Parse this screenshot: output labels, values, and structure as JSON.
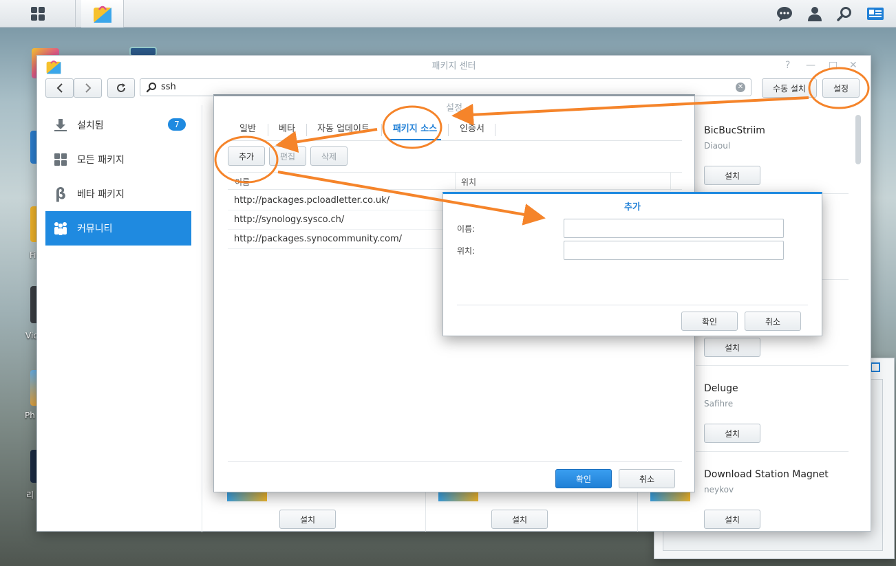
{
  "window": {
    "title": "패키지 센터",
    "search_value": "ssh",
    "manual_install_label": "수동 설치",
    "settings_label": "설정",
    "controls": {
      "help": "?",
      "minimize": "—",
      "maximize": "□",
      "close": "✕"
    }
  },
  "desktop": {
    "labels": [
      "Fi",
      "Vic",
      "Ph",
      "리"
    ]
  },
  "sidebar": {
    "items": [
      {
        "label": "설치됨",
        "icon": "download-icon",
        "badge": "7"
      },
      {
        "label": "모든 패키지",
        "icon": "grid-icon"
      },
      {
        "label": "베타 패키지",
        "icon": "beta-icon"
      },
      {
        "label": "커뮤니티",
        "icon": "community-icon"
      }
    ]
  },
  "packages": [
    {
      "name": "BicBucStriim",
      "author": "Diaoul",
      "install_label": "설치"
    },
    {
      "name": "",
      "author": "",
      "install_label": "설치"
    },
    {
      "name": "Deluge",
      "author": "Safihre",
      "install_label": "설치"
    },
    {
      "name": "Download Station Magnet",
      "author": "neykov",
      "install_label": "설치"
    }
  ],
  "bottom_install_labels": [
    "설치",
    "설치",
    "설치"
  ],
  "settings_dialog": {
    "title": "설정",
    "tabs": [
      "일반",
      "베타",
      "자동 업데이트",
      "패키지 소스",
      "인증서"
    ],
    "active_tab": "패키지 소스",
    "add_label": "추가",
    "edit_label": "편집",
    "delete_label": "삭제",
    "columns": {
      "name": "이름",
      "location": "위치"
    },
    "sources": [
      "http://packages.pcloadletter.co.uk/",
      "http://synology.sysco.ch/",
      "http://packages.synocommunity.com/"
    ],
    "ok_label": "확인",
    "cancel_label": "취소"
  },
  "add_dialog": {
    "title": "추가",
    "name_label": "이름:",
    "location_label": "위치:",
    "name_value": "",
    "location_value": "",
    "ok_label": "확인",
    "cancel_label": "취소"
  },
  "colors": {
    "accent": "#1f8ae0",
    "annotation": "#f5842a"
  }
}
